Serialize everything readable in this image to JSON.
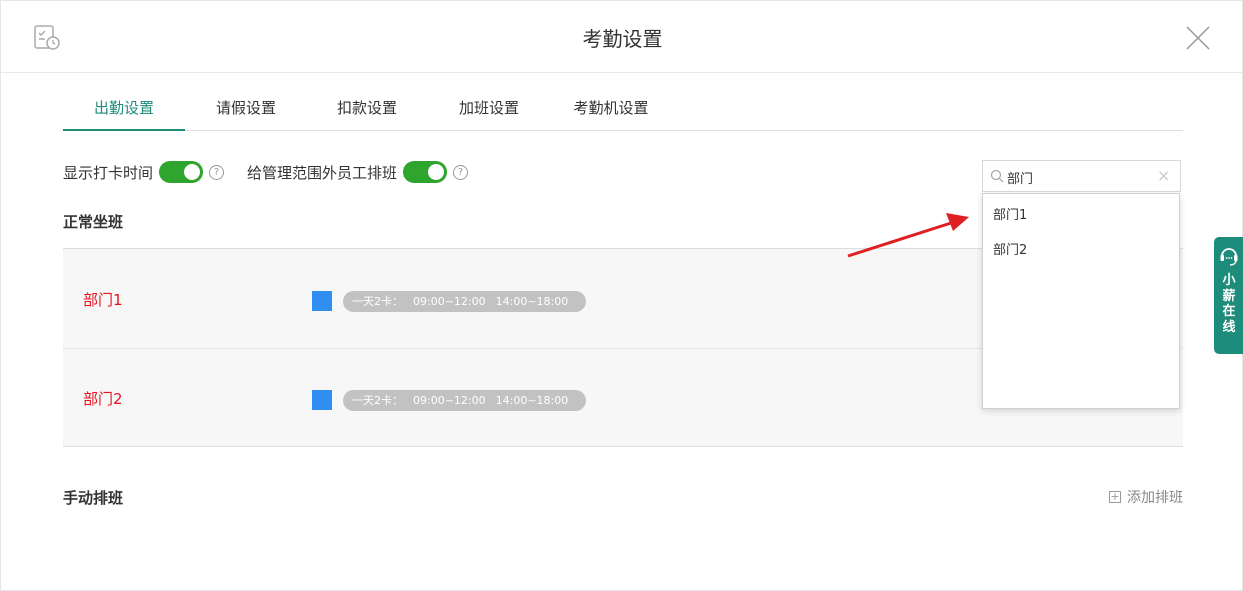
{
  "window": {
    "title": "考勤设置"
  },
  "tabs": [
    {
      "label": "出勤设置",
      "active": true
    },
    {
      "label": "请假设置",
      "active": false
    },
    {
      "label": "扣款设置",
      "active": false
    },
    {
      "label": "加班设置",
      "active": false
    },
    {
      "label": "考勤机设置",
      "active": false
    }
  ],
  "toggles": {
    "show_clock_time": {
      "label": "显示打卡时间",
      "on": true
    },
    "schedule_outside": {
      "label": "给管理范围外员工排班",
      "on": true
    }
  },
  "sections": {
    "normal_shift": "正常坐班",
    "manual_shift": "手动排班",
    "add_shift": "添加排班"
  },
  "shift_rows": [
    {
      "dept": "部门1",
      "shift_prefix": "一天2卡：",
      "shift_morning": "09:00~12:00",
      "shift_afternoon": "14:00~18:00"
    },
    {
      "dept": "部门2",
      "shift_prefix": "一天2卡：",
      "shift_morning": "09:00~12:00",
      "shift_afternoon": "14:00~18:00"
    }
  ],
  "search": {
    "value": "部门"
  },
  "dropdown": {
    "options": [
      "部门1",
      "部门2"
    ]
  },
  "chat_tab": {
    "chars": [
      "小",
      "薪",
      "在",
      "线"
    ]
  },
  "colors": {
    "accent": "#1e8c7a",
    "toggle_on": "#2fa52e",
    "dept_text": "#e4141e",
    "shift_color": "#2f8ef0",
    "arrow": "#e02020"
  }
}
